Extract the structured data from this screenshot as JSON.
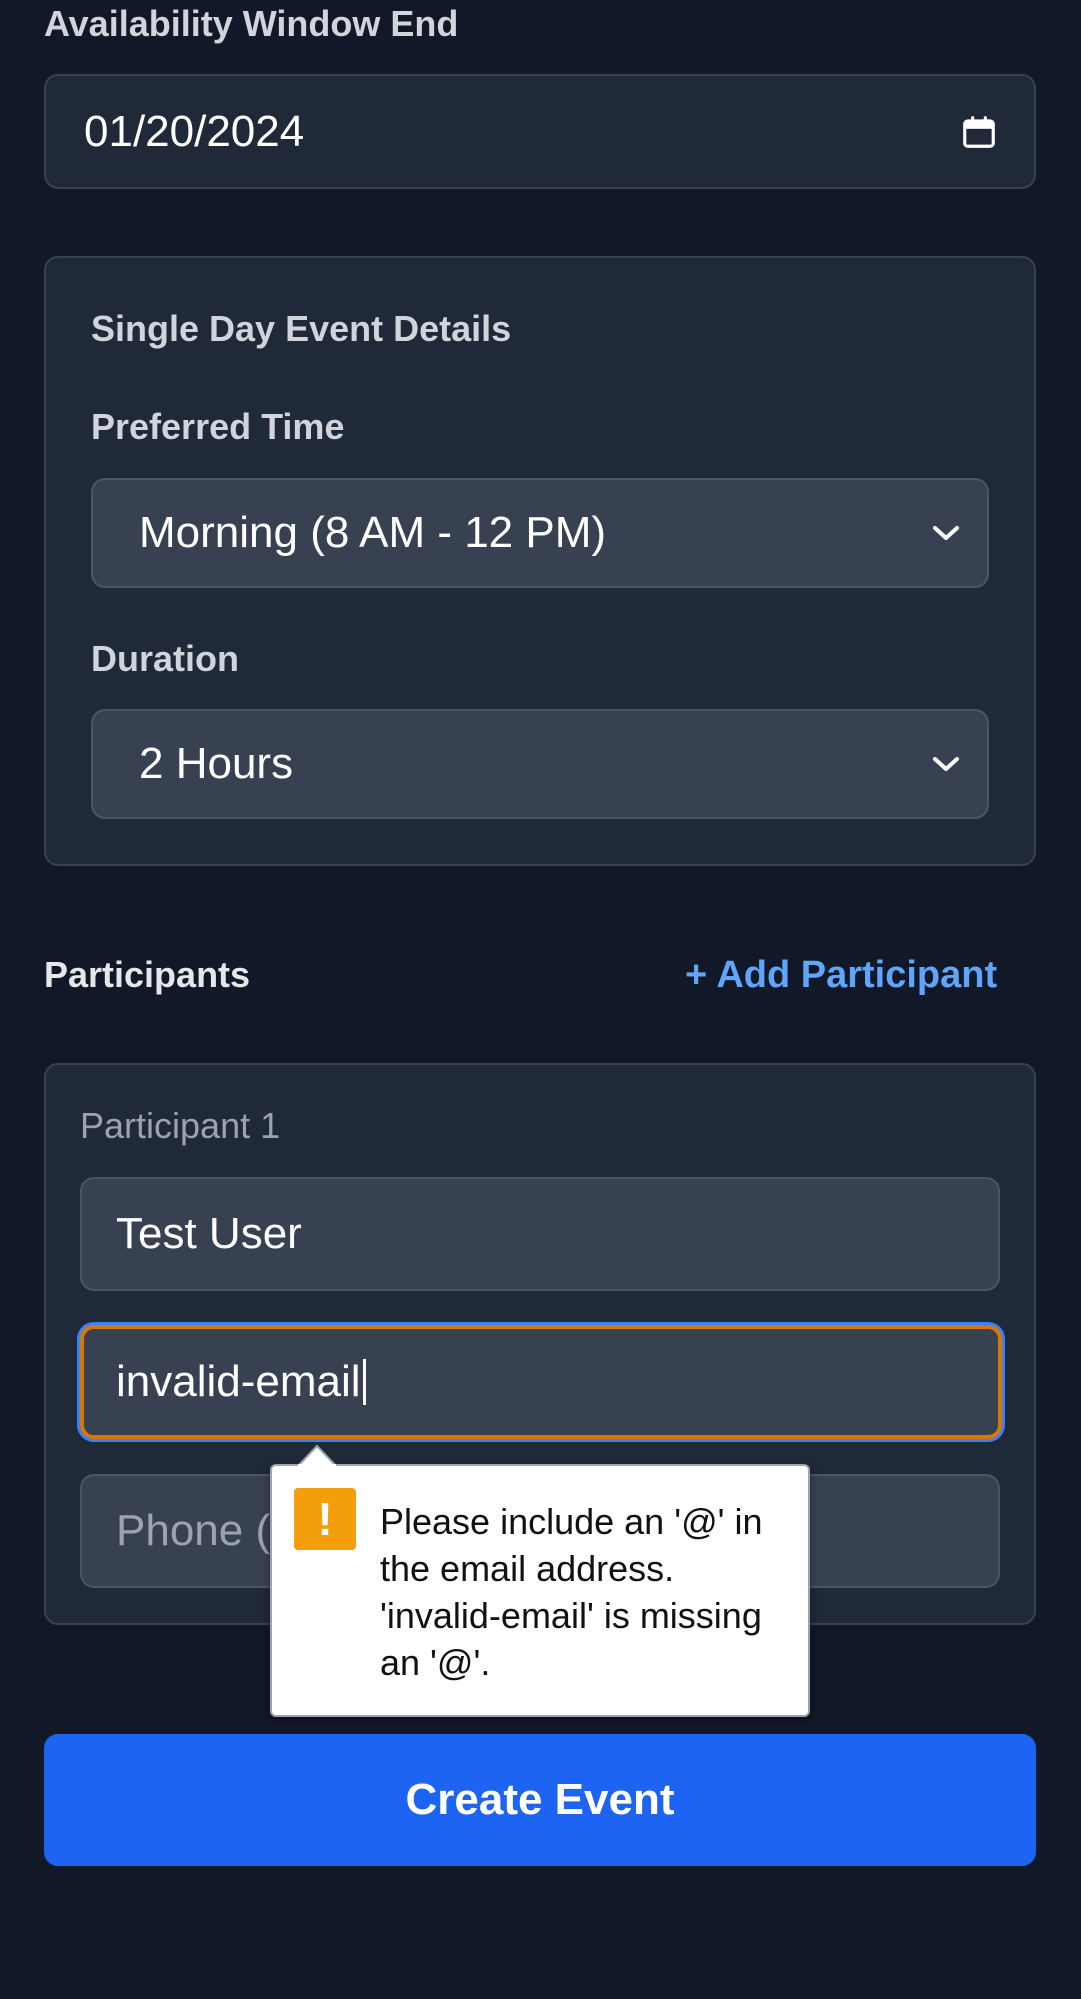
{
  "availability": {
    "end_label": "Availability Window End",
    "end_value": "01/20/2024"
  },
  "single_day": {
    "title": "Single Day Event Details",
    "preferred_time_label": "Preferred Time",
    "preferred_time_value": "Morning (8 AM - 12 PM)",
    "duration_label": "Duration",
    "duration_value": "2 Hours"
  },
  "participants": {
    "title": "Participants",
    "add_label": "+ Add Participant",
    "items": [
      {
        "heading": "Participant 1",
        "name_value": "Test User",
        "email_value": "invalid-email",
        "phone_placeholder": "Phone (optional)"
      }
    ]
  },
  "validation": {
    "icon": "exclamation-icon",
    "icon_glyph": "!",
    "message": "Please include an '@' in the email address. 'invalid-email' is missing an '@'.",
    "badge_color": "#f59e0b",
    "field_border_color": "#d97706"
  },
  "submit": {
    "label": "Create Event",
    "color": "#1d64f2"
  },
  "colors": {
    "background": "#111827",
    "panel": "#1f2937",
    "link": "#60a5fa"
  }
}
